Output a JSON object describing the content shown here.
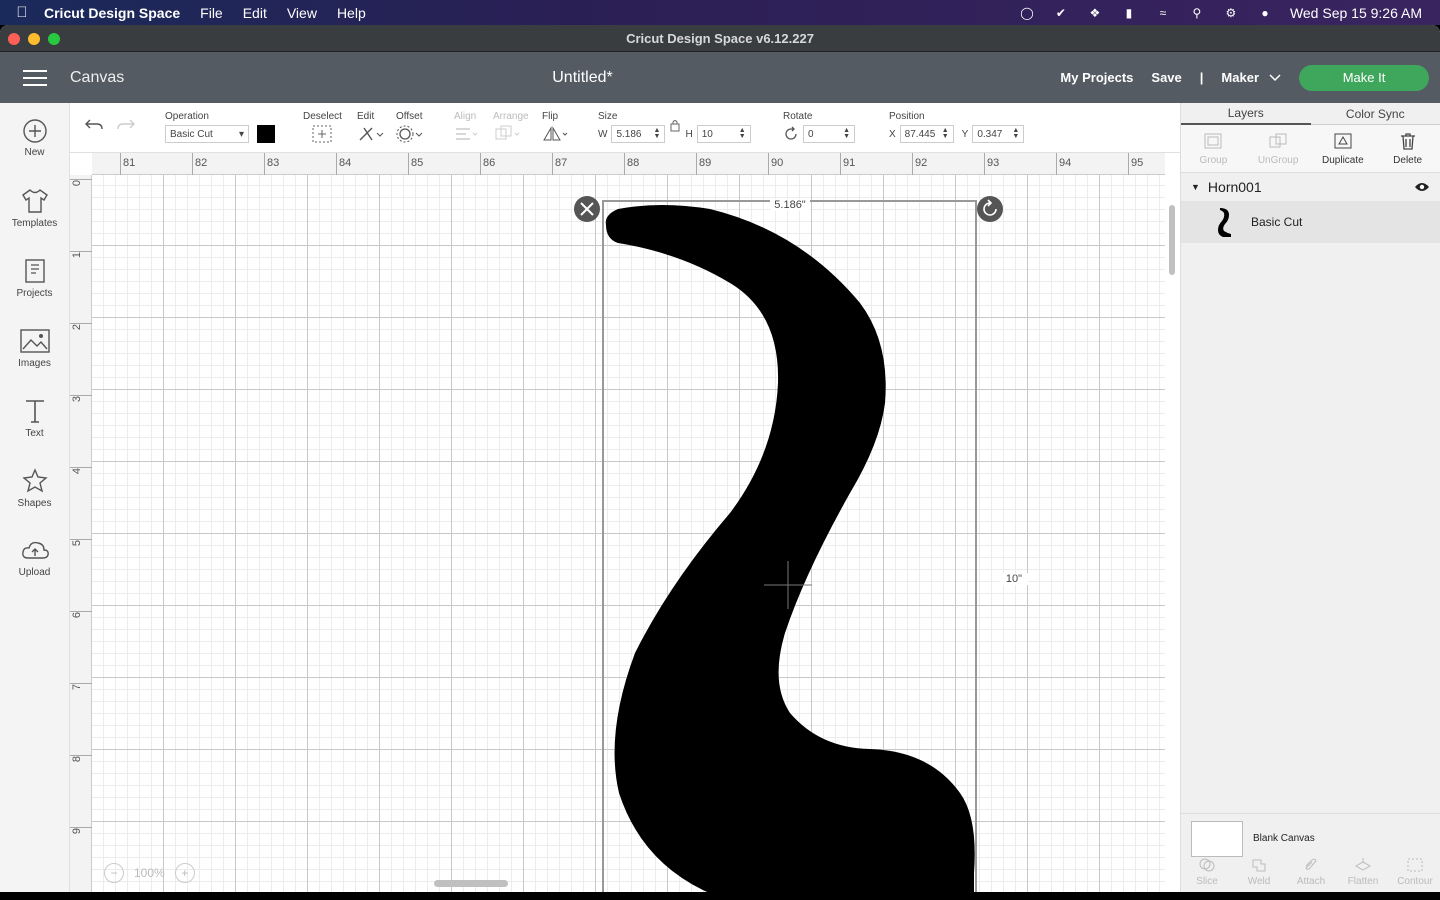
{
  "menubar": {
    "app_name": "Cricut Design Space",
    "items": [
      "File",
      "Edit",
      "View",
      "Help"
    ],
    "clock": "Wed Sep 15  9:26 AM"
  },
  "window": {
    "title": "Cricut Design Space  v6.12.227"
  },
  "header": {
    "section": "Canvas",
    "doc_title": "Untitled*",
    "my_projects": "My Projects",
    "save": "Save",
    "separator": "|",
    "machine": "Maker",
    "make_it": "Make It",
    "make_it_color": "#3fa75c"
  },
  "sidebar": {
    "items": [
      {
        "label": "New",
        "icon": "plus-circle-icon"
      },
      {
        "label": "Templates",
        "icon": "shirt-icon"
      },
      {
        "label": "Projects",
        "icon": "book-icon"
      },
      {
        "label": "Images",
        "icon": "image-icon"
      },
      {
        "label": "Text",
        "icon": "text-icon"
      },
      {
        "label": "Shapes",
        "icon": "shapes-icon"
      },
      {
        "label": "Upload",
        "icon": "upload-cloud-icon"
      }
    ]
  },
  "toolbar": {
    "operation_label": "Operation",
    "operation_value": "Basic Cut",
    "operation_color": "#000000",
    "deselect": "Deselect",
    "edit": "Edit",
    "offset": "Offset",
    "align": "Align",
    "arrange": "Arrange",
    "flip": "Flip",
    "size_label": "Size",
    "w_label": "W",
    "w_value": "5.186",
    "h_label": "H",
    "h_value": "10",
    "rotate_label": "Rotate",
    "rotate_value": "0",
    "position_label": "Position",
    "x_label": "X",
    "x_value": "87.445",
    "y_label": "Y",
    "y_value": "0.347"
  },
  "canvas": {
    "ruler_top": [
      "81",
      "82",
      "83",
      "84",
      "85",
      "86",
      "87",
      "88",
      "89",
      "90",
      "91",
      "92",
      "93",
      "94",
      "95"
    ],
    "ruler_left": [
      "0",
      "1",
      "2",
      "3",
      "4",
      "5",
      "6",
      "7",
      "8",
      "9"
    ],
    "width_dim": "5.186\"",
    "height_dim": "10\"",
    "zoom": "100%"
  },
  "panel": {
    "tabs": [
      "Layers",
      "Color Sync"
    ],
    "actions": [
      {
        "label": "Group",
        "enabled": false
      },
      {
        "label": "UnGroup",
        "enabled": false
      },
      {
        "label": "Duplicate",
        "enabled": true
      },
      {
        "label": "Delete",
        "enabled": true
      }
    ],
    "group_name": "Horn001",
    "layer_name": "Basic Cut",
    "blank_canvas": "Blank Canvas",
    "bottom_actions": [
      "Slice",
      "Weld",
      "Attach",
      "Flatten",
      "Contour"
    ]
  }
}
